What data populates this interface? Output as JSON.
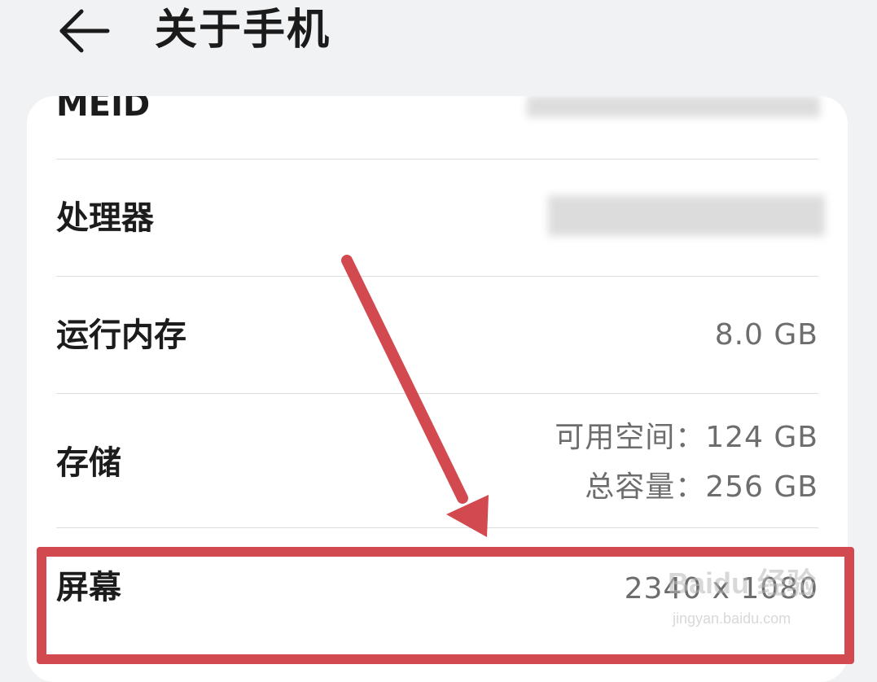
{
  "header": {
    "title": "关于手机"
  },
  "rows": [
    {
      "label": "MEID",
      "value": ""
    },
    {
      "label": "处理器",
      "value": ""
    },
    {
      "label": "运行内存",
      "value": "8.0 GB"
    },
    {
      "label": "存储",
      "value_line1": "可用空间：124  GB",
      "value_line2": "总容量：256  GB"
    },
    {
      "label": "屏幕",
      "value": "2340 x 1080"
    }
  ],
  "annotation": {
    "color": "#d24a4f"
  },
  "watermark": {
    "brand": "Baidu 经验",
    "url": "jingyan.baidu.com"
  }
}
